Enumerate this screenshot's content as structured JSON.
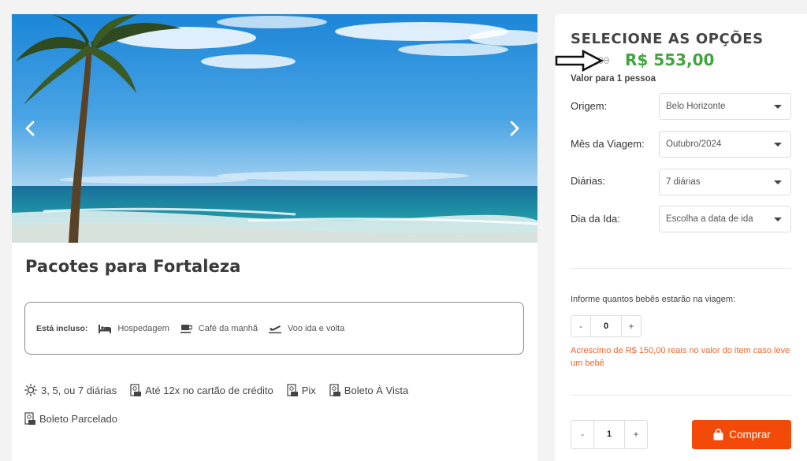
{
  "package": {
    "title": "Pacotes para Fortaleza",
    "included_label": "Está incluso:",
    "included": [
      {
        "icon": "bed-icon",
        "label": "Hospedagem"
      },
      {
        "icon": "coffee-icon",
        "label": "Café da manhã"
      },
      {
        "icon": "plane-icon",
        "label": "Voo ida e volta"
      }
    ],
    "features": [
      {
        "icon": "sun-icon",
        "label": "3, 5, ou 7 diárias"
      },
      {
        "icon": "receipt-icon",
        "label": "Até 12x no cartão de crédito"
      },
      {
        "icon": "receipt-icon",
        "label": "Pix"
      },
      {
        "icon": "receipt-icon",
        "label": "Boleto À Vista"
      },
      {
        "icon": "receipt-icon",
        "label": "Boleto Parcelado"
      }
    ]
  },
  "options": {
    "title": "SELECIONE AS OPÇÕES",
    "old_price": "R$ ...,00",
    "price": "R$ 553,00",
    "price_note": "Valor para 1 pessoa",
    "fields": [
      {
        "label": "Origem:",
        "value": "Belo Horizonte"
      },
      {
        "label": "Mês da Viagem:",
        "value": "Outubro/2024"
      },
      {
        "label": "Diárias:",
        "value": "7 diárias"
      },
      {
        "label": "Dia da Ida:",
        "value": "Escolha a data de ida"
      }
    ],
    "babies_label": "Informe quantos bebês estarão na viagem:",
    "babies_minus": "-",
    "babies_value": "0",
    "babies_plus": "+",
    "babies_note": "Acrescimo de R$ 150,00 reais no valor do item caso leve um bebê",
    "qty_minus": "-",
    "qty_value": "1",
    "qty_plus": "+",
    "buy_label": "Comprar"
  },
  "colors": {
    "price_green": "#43a43f",
    "buy_orange": "#f44a09",
    "note_orange": "#f2652c"
  }
}
